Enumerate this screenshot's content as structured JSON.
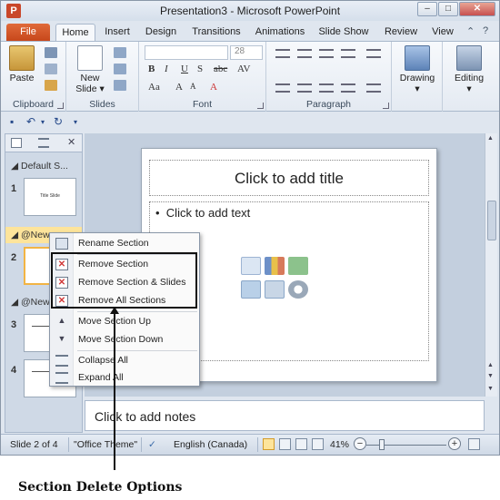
{
  "window": {
    "title": "Presentation3 - Microsoft PowerPoint",
    "app_icon_letter": "P",
    "controls": {
      "minimize": "–",
      "maximize": "□",
      "close": "✕"
    }
  },
  "ribbon_tabs": [
    "File",
    "Home",
    "Insert",
    "Design",
    "Transitions",
    "Animations",
    "Slide Show",
    "Review",
    "View"
  ],
  "active_tab": "Home",
  "ribbon": {
    "clipboard": {
      "paste_label": "Paste",
      "group_label": "Clipboard"
    },
    "slides": {
      "new_slide_label_line1": "New",
      "new_slide_label_line2": "Slide ▾",
      "group_label": "Slides"
    },
    "font": {
      "size_value": "28",
      "group_label": "Font"
    },
    "paragraph": {
      "group_label": "Paragraph"
    },
    "drawing": {
      "label": "Drawing"
    },
    "editing": {
      "label": "Editing"
    }
  },
  "left_pane": {
    "sections": [
      {
        "name": "Default S..."
      },
      {
        "name": "@New..."
      },
      {
        "name": "@New..."
      }
    ],
    "slides": [
      {
        "number": "1",
        "thumb_text": "Title Slide"
      },
      {
        "number": "2"
      },
      {
        "number": "3"
      },
      {
        "number": "4"
      }
    ]
  },
  "slide": {
    "title_placeholder": "Click to add title",
    "body_placeholder": "Click to add text",
    "bullet": "•"
  },
  "notes": {
    "placeholder": "Click to add notes"
  },
  "status_bar": {
    "slide_info": "Slide 2 of 4",
    "theme": "\"Office Theme\"",
    "language": "English (Canada)",
    "zoom": "41%"
  },
  "context_menu": {
    "items": [
      {
        "label": "Rename Section",
        "icon": "rename-section-icon"
      },
      {
        "label": "Remove Section",
        "icon": "remove-section-icon"
      },
      {
        "label": "Remove Section & Slides",
        "icon": "remove-section-slides-icon"
      },
      {
        "label": "Remove All Sections",
        "icon": "remove-all-sections-icon"
      },
      {
        "label": "Move Section Up",
        "icon": "move-up-icon"
      },
      {
        "label": "Move Section Down",
        "icon": "move-down-icon"
      },
      {
        "label": "Collapse All",
        "icon": "collapse-all-icon"
      },
      {
        "label": "Expand All",
        "icon": "expand-all-icon"
      }
    ]
  },
  "annotation": {
    "caption": "Section Delete Options"
  },
  "colors": {
    "file_tab": "#c7471b",
    "selected_section": "#fde49b",
    "remove_icon": "#d13a3a",
    "frame": "#dfe6ef"
  }
}
